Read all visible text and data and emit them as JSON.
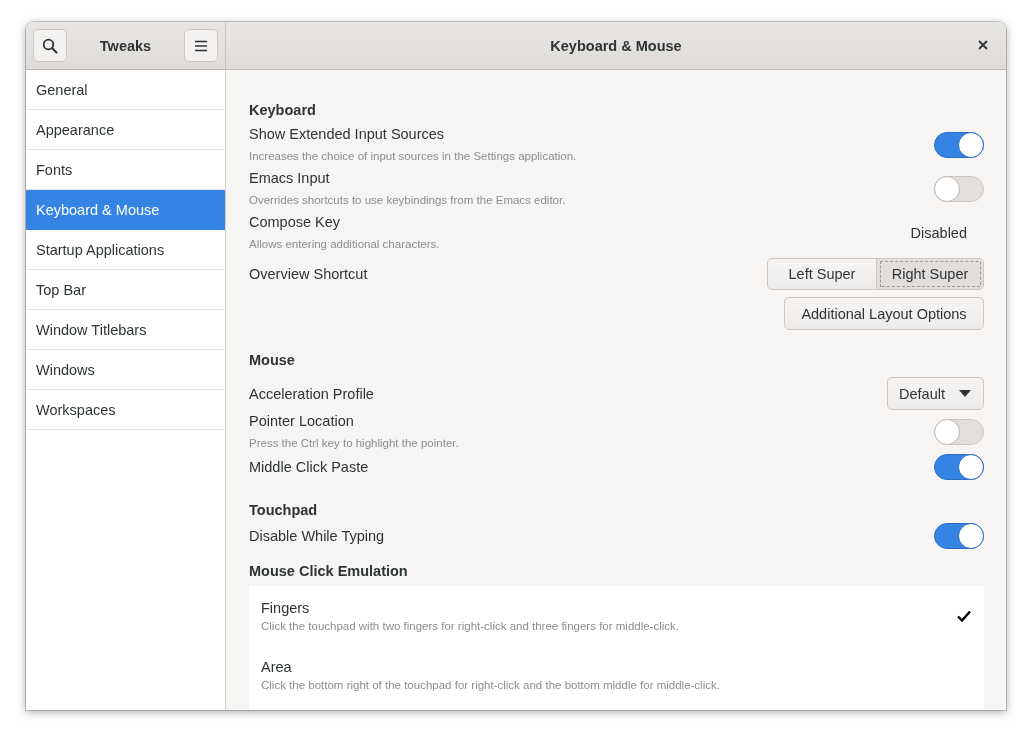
{
  "sidebar_header": {
    "title": "Tweaks"
  },
  "window": {
    "title": "Keyboard & Mouse"
  },
  "sidebar": {
    "items": [
      {
        "label": "General",
        "selected": false
      },
      {
        "label": "Appearance",
        "selected": false
      },
      {
        "label": "Fonts",
        "selected": false
      },
      {
        "label": "Keyboard & Mouse",
        "selected": true
      },
      {
        "label": "Startup Applications",
        "selected": false
      },
      {
        "label": "Top Bar",
        "selected": false
      },
      {
        "label": "Window Titlebars",
        "selected": false
      },
      {
        "label": "Windows",
        "selected": false
      },
      {
        "label": "Workspaces",
        "selected": false
      }
    ]
  },
  "sections": [
    {
      "title": "Keyboard",
      "rows": [
        {
          "kind": "toggle",
          "label": "Show Extended Input Sources",
          "description": "Increases the choice of input sources in the Settings application.",
          "on": true
        },
        {
          "kind": "toggle",
          "label": "Emacs Input",
          "description": "Overrides shortcuts to use keybindings from the Emacs editor.",
          "on": false
        },
        {
          "kind": "value",
          "label": "Compose Key",
          "description": "Allows entering additional characters.",
          "value": "Disabled"
        },
        {
          "kind": "segmented",
          "label": "Overview Shortcut",
          "options": [
            {
              "label": "Left Super",
              "selected": false
            },
            {
              "label": "Right Super",
              "selected": true
            }
          ]
        },
        {
          "kind": "button",
          "label": "Additional Layout Options"
        }
      ]
    },
    {
      "title": "Mouse",
      "rows": [
        {
          "kind": "dropdown",
          "label": "Acceleration Profile",
          "value": "Default"
        },
        {
          "kind": "toggle",
          "label": "Pointer Location",
          "description": "Press the Ctrl key to highlight the pointer.",
          "on": false
        },
        {
          "kind": "toggle",
          "label": "Middle Click Paste",
          "on": true
        }
      ]
    },
    {
      "title": "Touchpad",
      "rows": [
        {
          "kind": "toggle",
          "label": "Disable While Typing",
          "on": true
        },
        {
          "kind": "choices",
          "title": "Mouse Click Emulation",
          "options": [
            {
              "label": "Fingers",
              "description": "Click the touchpad with two fingers for right-click and three fingers for middle-click.",
              "selected": true
            },
            {
              "label": "Area",
              "description": "Click the bottom right of the touchpad for right-click and the bottom middle for middle-click.",
              "selected": false
            }
          ]
        }
      ]
    }
  ]
}
